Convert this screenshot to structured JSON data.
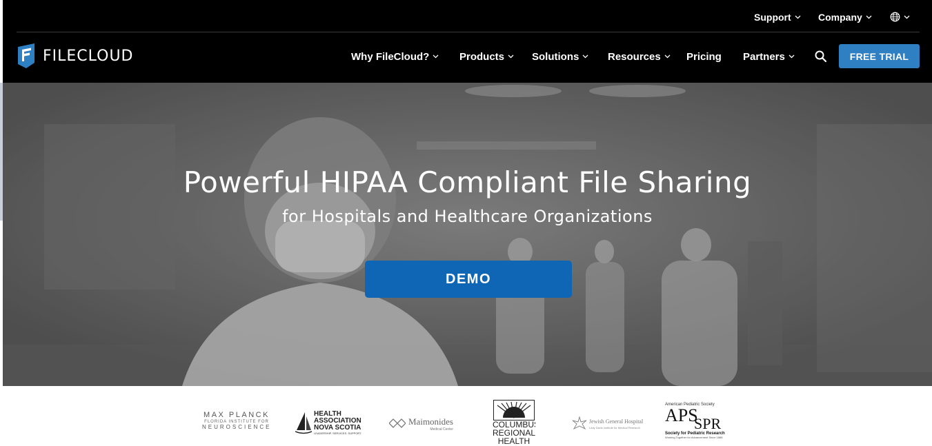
{
  "brand": {
    "name": "FILECLOUD",
    "accent": "#2f80c2",
    "demo_color": "#0e66b5"
  },
  "topbar": {
    "items": [
      {
        "label": "Support",
        "icon": "chevron-down-icon"
      },
      {
        "label": "Company",
        "icon": "chevron-down-icon"
      },
      {
        "label": "",
        "icon": "globe-icon"
      }
    ]
  },
  "nav": {
    "items": [
      {
        "label": "Why FileCloud?",
        "has_dropdown": true
      },
      {
        "label": "Products",
        "has_dropdown": true
      },
      {
        "label": "Solutions",
        "has_dropdown": true
      },
      {
        "label": "Resources",
        "has_dropdown": true
      },
      {
        "label": "Pricing",
        "has_dropdown": false
      },
      {
        "label": "Partners",
        "has_dropdown": true
      }
    ],
    "search_icon": "search-icon",
    "cta_label": "FREE TRIAL"
  },
  "hero": {
    "title": "Powerful HIPAA Compliant File Sharing",
    "subtitle": "for Hospitals and Healthcare Organizations",
    "button_label": "DEMO"
  },
  "client_logos": [
    {
      "name": "max-planck",
      "lines": [
        "MAX PLANCK",
        "FLORIDA INSTITUTE FOR",
        "NEUROSCIENCE"
      ]
    },
    {
      "name": "health-association-nova-scotia",
      "lines": [
        "HEALTH",
        "ASSOCIATION",
        "NOVA SCOTIA",
        "LEADERSHIP. SERVICES. SUPPORT."
      ]
    },
    {
      "name": "maimonides",
      "lines": [
        "Maimonides",
        "Medical Center"
      ]
    },
    {
      "name": "columbus-regional-health",
      "lines": [
        "COLUMBUS",
        "REGIONAL",
        "HEALTH"
      ]
    },
    {
      "name": "jewish-general-hospital",
      "lines": [
        "Jewish General Hospital",
        "Lady Davis Institute for Medical Research"
      ]
    },
    {
      "name": "aps-spr",
      "lines": [
        "American Pediatric Society",
        "APS",
        "SPR",
        "Society for Pediatric Research",
        "Working Together for Advancement Since 1888"
      ]
    }
  ]
}
